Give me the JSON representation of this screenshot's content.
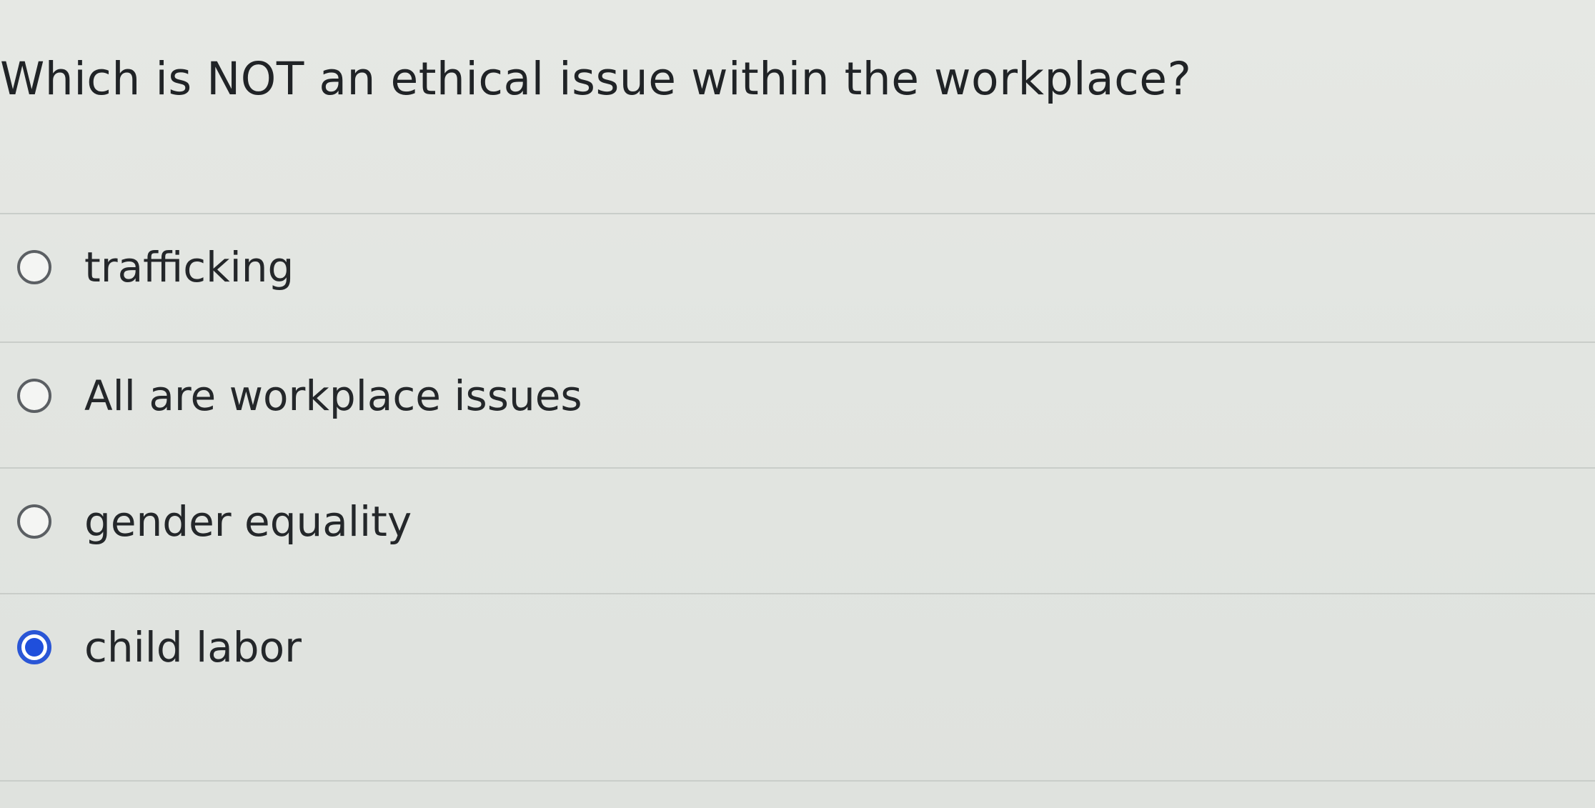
{
  "question": {
    "text": "Which is NOT an ethical issue within the workplace?"
  },
  "choices": [
    {
      "label": "trafficking",
      "selected": false
    },
    {
      "label": "All are workplace issues",
      "selected": false
    },
    {
      "label": "gender equality",
      "selected": false
    },
    {
      "label": "child labor",
      "selected": true
    }
  ],
  "colors": {
    "selected_radio": "#1f4fdc",
    "background": "#e2e5e1",
    "text": "#202326"
  }
}
